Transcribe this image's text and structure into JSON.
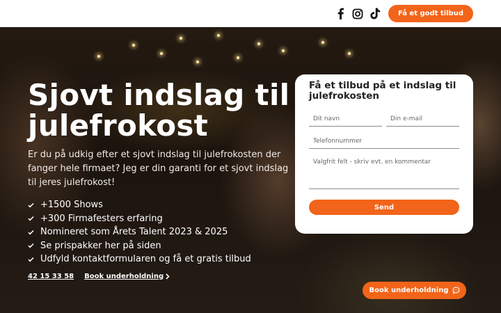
{
  "header": {
    "social": [
      {
        "icon": "facebook-icon",
        "glyph": "f"
      },
      {
        "icon": "instagram-icon"
      },
      {
        "icon": "tiktok-icon"
      }
    ],
    "cta_label": "Få et godt tilbud"
  },
  "hero": {
    "title": "Sjovt indslag til julefrokost",
    "description": "Er du på udkig efter et sjovt indslag til julefrokosten der fanger hele firmaet? Jeg er din garanti for et sjovt indslag til jeres julefrokost!",
    "features": [
      "+1500 Shows",
      "+300 Firmafesters erfaring",
      "Nomineret som Årets Talent 2023 & 2025",
      "Se prispakker her på siden",
      "Udfyld kontaktformularen og få et gratis tilbud"
    ],
    "phone_link": "42 15 33 58",
    "book_link": "Book underholdning"
  },
  "form": {
    "title": "Få et tilbud på et indslag til julefrokosten",
    "name_placeholder": "Dit navn",
    "email_placeholder": "Din e-mail",
    "phone_placeholder": "Telefonnummer",
    "comment_placeholder": "Valgfrit felt - skriv evt. en kommentar",
    "submit_label": "Send"
  },
  "floating_cta": {
    "label": "Book underholdning",
    "icon": "chat-bubble-icon"
  },
  "colors": {
    "accent": "#f26419",
    "header_bg": "#ffffff",
    "form_bg": "#ffffff"
  }
}
